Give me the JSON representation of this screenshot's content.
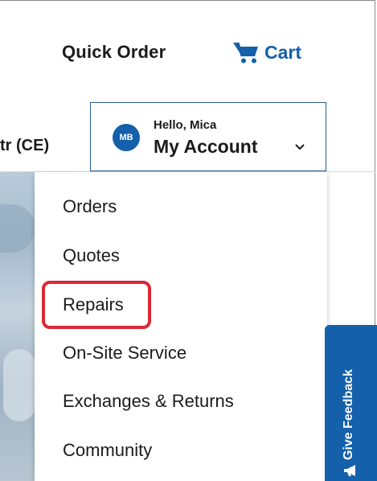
{
  "header": {
    "quick_order_label": "Quick Order",
    "cart_label": "Cart",
    "cart_icon": "cart-icon",
    "store_fragment": "tr (CE)"
  },
  "account": {
    "avatar_initials": "MB",
    "greeting": "Hello, Mica",
    "label": "My Account",
    "chevron_icon": "chevron-down-icon"
  },
  "menu": {
    "items": [
      {
        "label": "Orders"
      },
      {
        "label": "Quotes"
      },
      {
        "label": "Repairs",
        "highlighted": true
      },
      {
        "label": "On-Site Service"
      },
      {
        "label": "Exchanges & Returns"
      },
      {
        "label": "Community"
      }
    ]
  },
  "feedback": {
    "label": "Give Feedback",
    "icon": "megaphone-icon"
  },
  "colors": {
    "accent": "#1460aa",
    "highlight": "#d92a34",
    "text": "#1b1b1b"
  }
}
